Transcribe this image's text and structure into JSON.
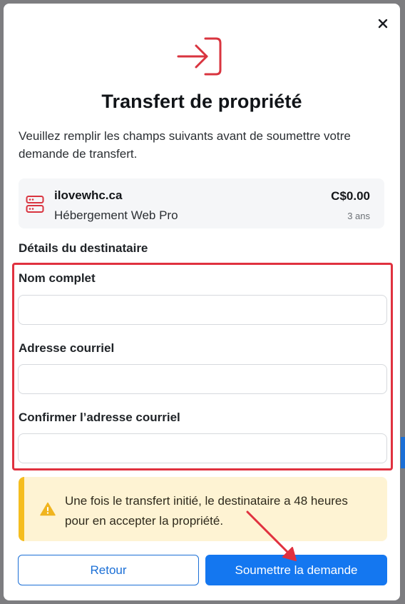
{
  "modal": {
    "title": "Transfert de propriété",
    "intro": "Veuillez remplir les champs suivants avant de soumettre votre demande de transfert.",
    "close_icon": "close-icon",
    "hero_icon": "sign-in-arrow-icon"
  },
  "domain": {
    "name": "ilovewhc.ca",
    "product": "Hébergement Web Pro",
    "price": "C$0.00",
    "term": "3 ans",
    "icon": "server-icon"
  },
  "recipient": {
    "section_title": "Détails du destinataire",
    "fields": [
      {
        "label": "Nom complet",
        "value": ""
      },
      {
        "label": "Adresse courriel",
        "value": ""
      },
      {
        "label": "Confirmer l’adresse courriel",
        "value": ""
      }
    ]
  },
  "notice": {
    "text": "Une fois le transfert initié, le destinataire a 48 heures pour en accepter la propriété.",
    "icon": "warning-icon"
  },
  "buttons": {
    "back": "Retour",
    "submit": "Soumettre la demande"
  },
  "colors": {
    "accent_red": "#d9343f",
    "primary_blue": "#1477f0",
    "warning_bg": "#fef3d3",
    "warning_bar": "#f5bd1f"
  }
}
